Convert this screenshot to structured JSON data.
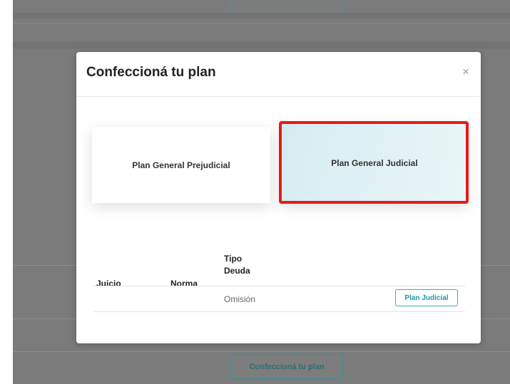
{
  "background": {
    "bottom_button_label": "Confeccioná tu plan"
  },
  "modal": {
    "title": "Confeccioná tu plan",
    "close_icon": "×",
    "cards": [
      {
        "label": "Plan General Prejudicial"
      },
      {
        "label": "Plan General Judicial"
      }
    ],
    "table": {
      "headers": {
        "juicio": "Juicio",
        "norma": "Norma",
        "tipo_deuda": "Tipo\nDeuda"
      },
      "rows": [
        {
          "juicio": "",
          "norma": "",
          "tipo_deuda": "Omisión",
          "action_label": "Plan Judicial"
        }
      ]
    }
  },
  "colors": {
    "accent": "#1e96a6",
    "highlight": "#e61a1a",
    "selected_card_bg": "#d6ecf0"
  }
}
